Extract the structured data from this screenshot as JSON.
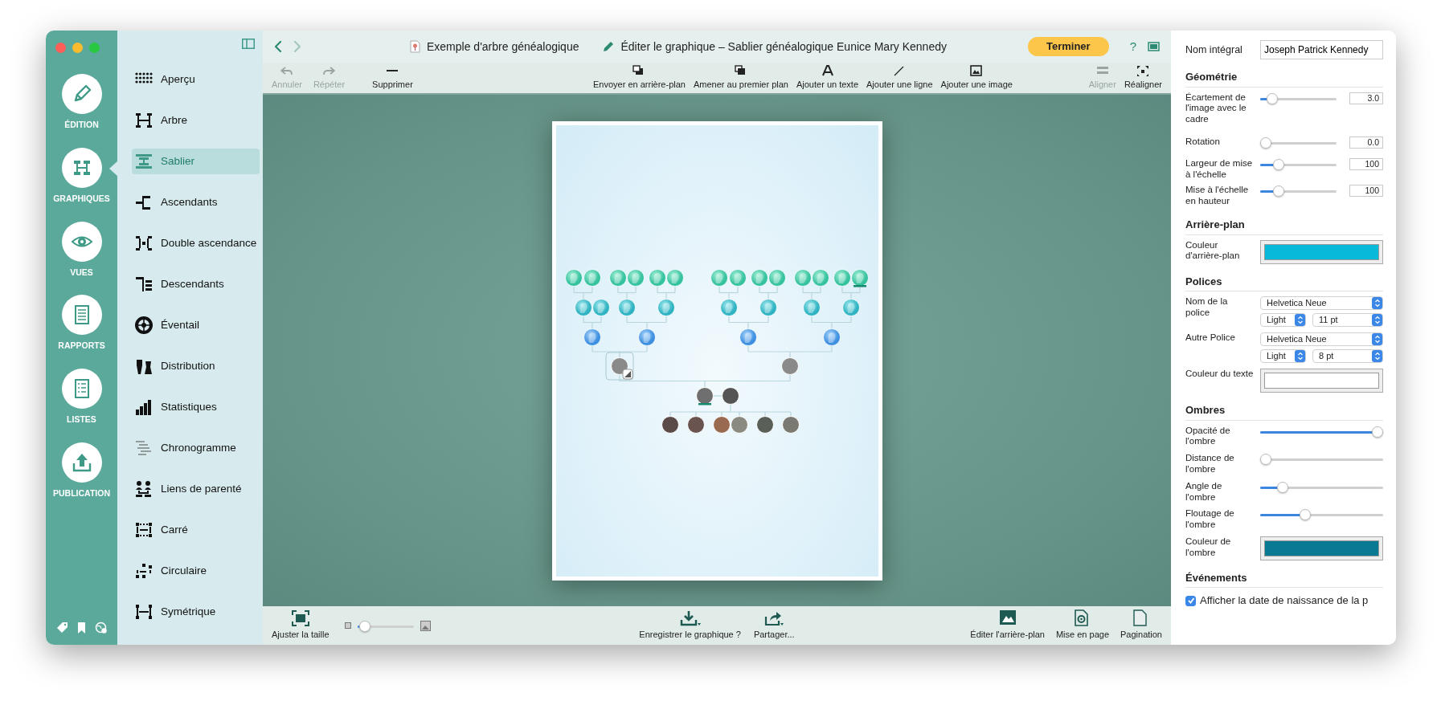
{
  "rail": {
    "items": [
      {
        "label": "ÉDITION",
        "selected": false
      },
      {
        "label": "GRAPHIQUES",
        "selected": true
      },
      {
        "label": "VUES",
        "selected": false
      },
      {
        "label": "RAPPORTS",
        "selected": false
      },
      {
        "label": "LISTES",
        "selected": false
      },
      {
        "label": "PUBLICATION",
        "selected": false
      }
    ]
  },
  "sidebar": {
    "items": [
      {
        "label": "Aperçu",
        "selected": false
      },
      {
        "label": "Arbre",
        "selected": false
      },
      {
        "label": "Sablier",
        "selected": true
      },
      {
        "label": "Ascendants",
        "selected": false
      },
      {
        "label": "Double ascendance",
        "selected": false
      },
      {
        "label": "Descendants",
        "selected": false
      },
      {
        "label": "Éventail",
        "selected": false
      },
      {
        "label": "Distribution",
        "selected": false
      },
      {
        "label": "Statistiques",
        "selected": false
      },
      {
        "label": "Chronogramme",
        "selected": false
      },
      {
        "label": "Liens de parenté",
        "selected": false
      },
      {
        "label": "Carré",
        "selected": false
      },
      {
        "label": "Circulaire",
        "selected": false
      },
      {
        "label": "Symétrique",
        "selected": false
      }
    ]
  },
  "header": {
    "back_disabled": false,
    "forward_disabled": true,
    "document_title": "Exemple d'arbre généalogique",
    "edit_title": "Éditer le graphique – Sablier généalogique Eunice Mary Kennedy",
    "finish_button": "Terminer",
    "help_button": "?"
  },
  "toolbar": {
    "left": [
      {
        "label": "Annuler",
        "disabled": true
      },
      {
        "label": "Répéter",
        "disabled": true
      },
      {
        "label": "Supprimer",
        "disabled": false
      }
    ],
    "center": [
      {
        "label": "Envoyer en arrière-plan",
        "disabled": false
      },
      {
        "label": "Amener au premier plan",
        "disabled": false
      },
      {
        "label": "Ajouter un texte",
        "disabled": false
      },
      {
        "label": "Ajouter une ligne",
        "disabled": false
      },
      {
        "label": "Ajouter une image",
        "disabled": false
      }
    ],
    "right": [
      {
        "label": "Aligner",
        "disabled": true
      },
      {
        "label": "Réaligner",
        "disabled": false
      }
    ]
  },
  "bottom_bar": {
    "fit_button": "Ajuster la taille",
    "zoom": {
      "level": 0.05
    },
    "center": [
      "Enregistrer le graphique ?",
      "Partager..."
    ],
    "right": [
      "Éditer l'arrière-plan",
      "Mise en page",
      "Pagination"
    ]
  },
  "inspector": {
    "full_name": {
      "label": "Nom intégral",
      "value": "Joseph Patrick Kennedy"
    },
    "sections": [
      {
        "title": "Géométrie",
        "rows": [
          {
            "kind": "slider",
            "label": "Écartement de l'image avec le cadre",
            "level": 0.1,
            "value": "3.0"
          },
          {
            "kind": "slider",
            "label": "Rotation",
            "level": 0.0,
            "value": "0.0"
          },
          {
            "kind": "slider",
            "label": "Largeur de mise à l'échelle",
            "level": 0.2,
            "value": "100"
          },
          {
            "kind": "slider",
            "label": "Mise à l'échelle en hauteur",
            "level": 0.2,
            "value": "100"
          }
        ]
      },
      {
        "title": "Arrière-plan",
        "rows": [
          {
            "kind": "color",
            "label": "Couleur d'arrière-plan",
            "color": "#08b9d9"
          }
        ]
      },
      {
        "title": "Polices",
        "rows": [
          {
            "kind": "font",
            "label": "Nom de la police",
            "family": "Helvetica Neue",
            "weight": "Light",
            "size": "11 pt"
          },
          {
            "kind": "font",
            "label": "Autre Police",
            "family": "Helvetica Neue",
            "weight": "Light",
            "size": "8 pt"
          },
          {
            "kind": "color",
            "label": "Couleur du texte",
            "color": "#ffffff"
          }
        ]
      },
      {
        "title": "Ombres",
        "rows": [
          {
            "kind": "slider",
            "label": "Opacité de l'ombre",
            "level": 1.0
          },
          {
            "kind": "slider",
            "label": "Distance de l'ombre",
            "level": 0.0
          },
          {
            "kind": "slider",
            "label": "Angle de l'ombre",
            "level": 0.15
          },
          {
            "kind": "slider",
            "label": "Floutage de l'ombre",
            "level": 0.35
          },
          {
            "kind": "color",
            "label": "Couleur de l'ombre",
            "color": "#0a7a92"
          }
        ]
      },
      {
        "title": "Événements",
        "rows": [
          {
            "kind": "checkbox",
            "label": "Afficher la date de naissance de la p",
            "checked": true
          }
        ]
      }
    ]
  }
}
